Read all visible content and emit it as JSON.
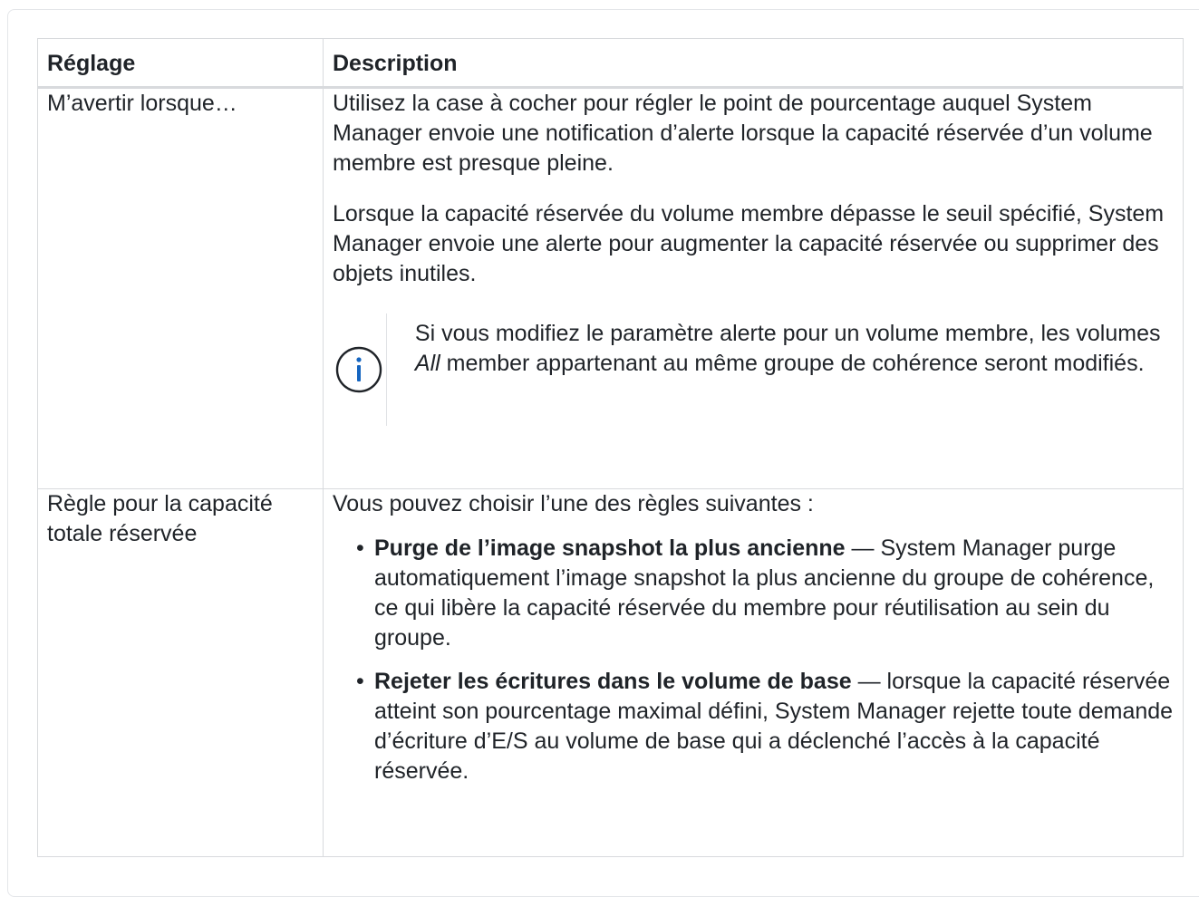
{
  "table": {
    "headers": [
      "Réglage",
      "Description"
    ],
    "rows": [
      {
        "setting": "M’avertir lorsque…",
        "paragraphs": [
          "Utilisez la case à cocher pour régler le point de pourcentage auquel System Manager envoie une notification d’alerte lorsque la capacité réservée d’un volume membre est presque pleine.",
          "Lorsque la capacité réservée du volume membre dépasse le seuil spécifié, System Manager envoie une alerte pour augmenter la capacité réservée ou supprimer des objets inutiles."
        ],
        "note": {
          "icon": "info-circle-icon",
          "before": "Si vous modifiez le paramètre alerte pour un volume membre, les volumes ",
          "emphasis": "All",
          "after": " member appartenant au même groupe de cohérence seront modifiés."
        }
      },
      {
        "setting": "Règle pour la capacité totale réservée",
        "intro": "Vous pouvez choisir l’une des règles suivantes :",
        "rules": [
          {
            "term": "Purge de l’image snapshot la plus ancienne",
            "desc": " — System Manager purge automatiquement l’image snapshot la plus ancienne du groupe de cohérence, ce qui libère la capacité réservée du membre pour réutilisation au sein du groupe."
          },
          {
            "term": "Rejeter les écritures dans le volume de base",
            "desc": " — lorsque la capacité réservée atteint son pourcentage maximal défini, System Manager rejette toute demande d’écriture d’E/S au volume de base qui a déclenché l’accès à la capacité réservée."
          }
        ]
      }
    ]
  },
  "colors": {
    "border": "#d8dadd",
    "info_icon": "#1565c0",
    "text": "#1f2328"
  }
}
